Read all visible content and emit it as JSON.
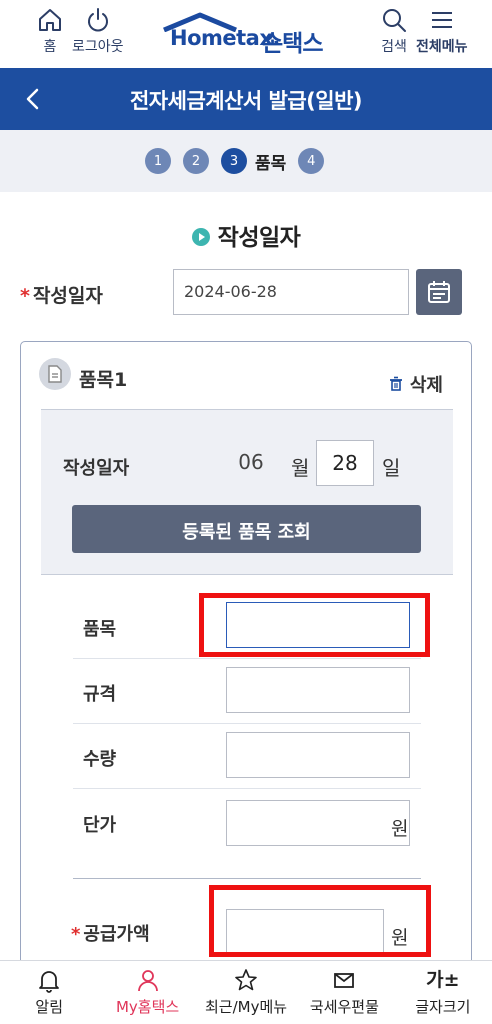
{
  "header": {
    "home_label": "홈",
    "logout_label": "로그아웃",
    "logo_text": "Hometax.",
    "logo_kr": "손택스",
    "search_label": "검색",
    "menu_label": "전체메뉴"
  },
  "titlebar": {
    "title": "전자세금계산서 발급(일반)"
  },
  "steps": {
    "items": [
      "1",
      "2",
      "3",
      "4"
    ],
    "active_label": "품목"
  },
  "section": {
    "title": "작성일자"
  },
  "date_row": {
    "label": "작성일자",
    "value": "2024-06-28"
  },
  "card": {
    "title": "품목1",
    "delete_label": "삭제",
    "date_label": "작성일자",
    "month_value": "06",
    "month_unit": "월",
    "day_value": "28",
    "day_unit": "일",
    "lookup_button": "등록된 품목 조회",
    "rows": {
      "item": "품목",
      "spec": "규격",
      "qty": "수량",
      "price": "단가",
      "supply": "공급가액"
    },
    "won_unit": "원"
  },
  "bottom_nav": {
    "alerts": "알림",
    "my_hometax": "My홈택스",
    "recent": "최근/My메뉴",
    "mail": "국세우편물",
    "font_size": "글자크기",
    "font_icon_text": "가±"
  },
  "colors": {
    "brand_blue": "#1d4ea0",
    "highlight_red": "#ee1111",
    "active_nav": "#e0365a"
  }
}
